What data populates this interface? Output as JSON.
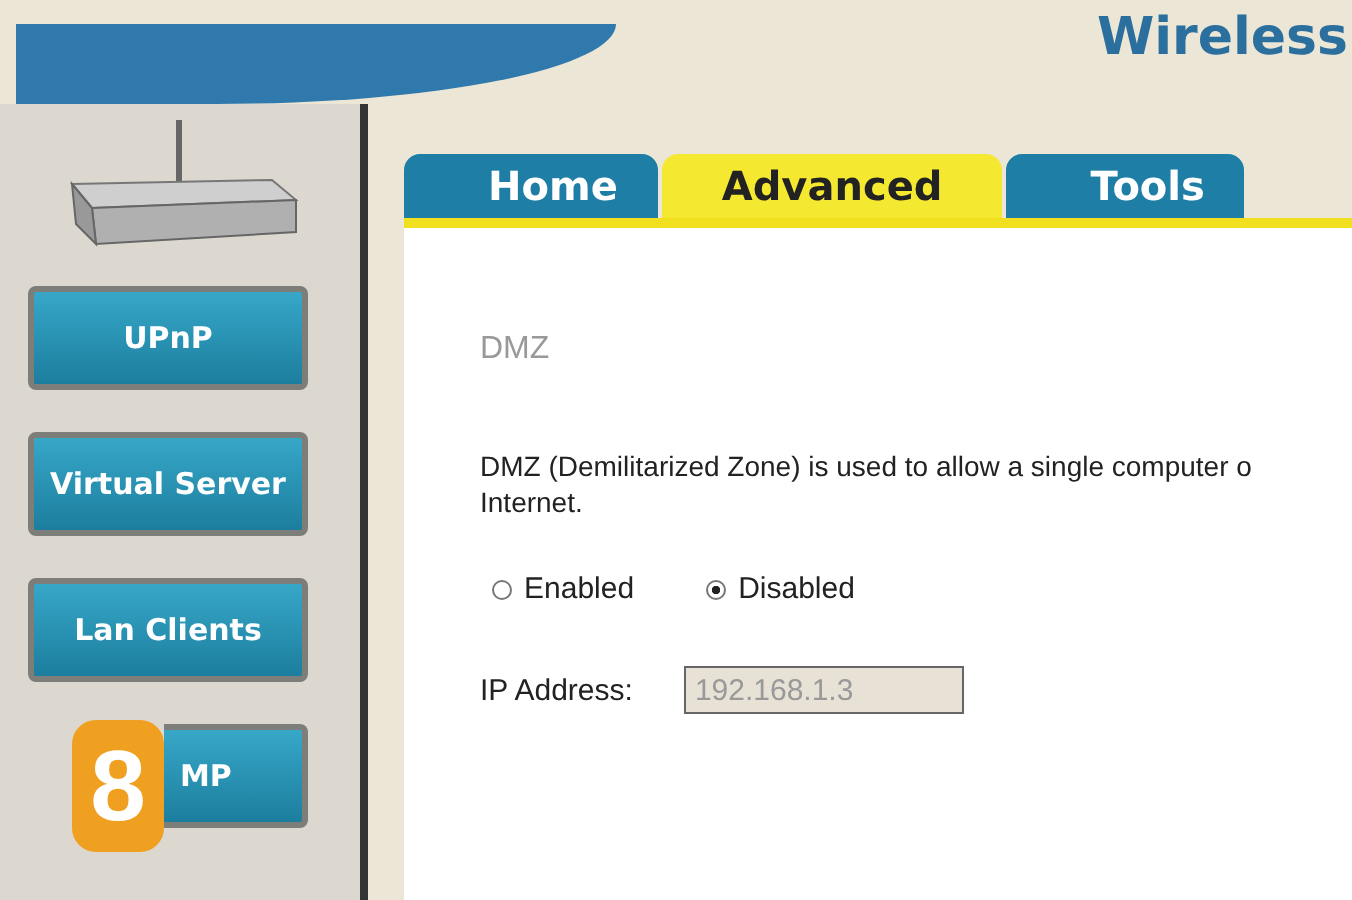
{
  "header": {
    "brand": "Wireless"
  },
  "sidebar": {
    "items": [
      {
        "label": "UPnP"
      },
      {
        "label": "Virtual Server"
      },
      {
        "label": "Lan Clients"
      },
      {
        "label": "MP",
        "badge": "8"
      }
    ]
  },
  "tabs": [
    {
      "label": "Home",
      "selected": false
    },
    {
      "label": "Advanced",
      "selected": true
    },
    {
      "label": "Tools",
      "selected": false
    }
  ],
  "content": {
    "title": "DMZ",
    "description": "DMZ (Demilitarized Zone) is used to allow a single computer o Internet.",
    "mode": [
      {
        "label": "Enabled",
        "selected": false
      },
      {
        "label": "Disabled",
        "selected": true
      }
    ],
    "ip_address": {
      "label": "IP Address:",
      "value": "192.168.1.3",
      "disabled": true
    }
  }
}
